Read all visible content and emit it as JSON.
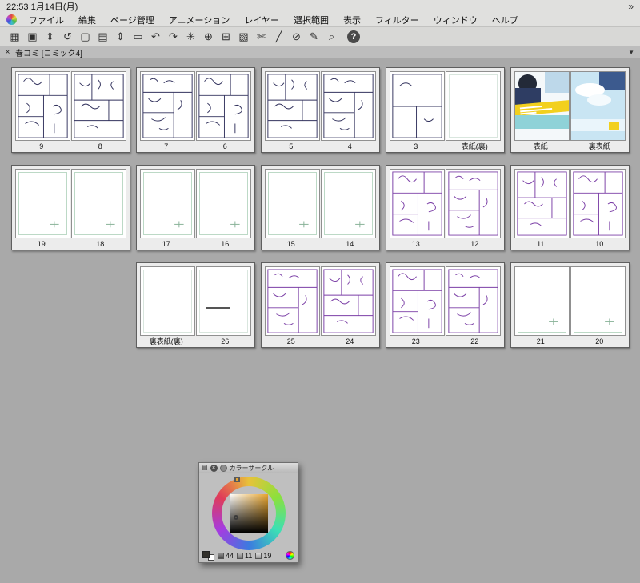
{
  "status_bar": {
    "clock": "22:53  1月14日(月)",
    "overflow_icon": "»"
  },
  "menu_bar": {
    "items": [
      "ファイル",
      "編集",
      "ページ管理",
      "アニメーション",
      "レイヤー",
      "選択範囲",
      "表示",
      "フィルター",
      "ウィンドウ",
      "ヘルプ"
    ]
  },
  "toolbar": {
    "buttons": [
      {
        "name": "page-manager-view-icon",
        "glyph": "▦"
      },
      {
        "name": "two-page-spread-icon",
        "glyph": "▣"
      },
      {
        "name": "page-stepper-icon",
        "glyph": "⇕"
      },
      {
        "name": "rotate-view-icon",
        "glyph": "↺"
      },
      {
        "name": "new-page-icon",
        "glyph": "▢"
      },
      {
        "name": "duplicate-page-icon",
        "glyph": "▤"
      },
      {
        "name": "order-stepper-icon",
        "glyph": "⇕"
      },
      {
        "name": "blank-template-icon",
        "glyph": "▭"
      },
      {
        "name": "undo-icon",
        "glyph": "↶"
      },
      {
        "name": "redo-icon",
        "glyph": "↷"
      },
      {
        "name": "clear-icon",
        "glyph": "✳"
      },
      {
        "name": "transform-icon",
        "glyph": "⊕"
      },
      {
        "name": "grid-icon",
        "glyph": "⊞"
      },
      {
        "name": "select-area-icon",
        "glyph": "▧"
      },
      {
        "name": "scissors-icon",
        "glyph": "✄"
      },
      {
        "name": "line-tool-icon",
        "glyph": "╱"
      },
      {
        "name": "no-tool-icon",
        "glyph": "⊘"
      },
      {
        "name": "pen-tool-icon",
        "glyph": "✎"
      },
      {
        "name": "search-icon",
        "glyph": "⌕"
      },
      {
        "name": "help-icon",
        "glyph": "?",
        "style": "dark"
      }
    ]
  },
  "tab_bar": {
    "close_label": "×",
    "title": "春コミ [コミック4]",
    "dropdown_icon": "▼"
  },
  "pages": {
    "rows": [
      {
        "spreads": [
          {
            "ink": "#33335e",
            "pages": [
              {
                "label": "9",
                "content": "sketch-0"
              },
              {
                "label": "8",
                "content": "sketch-1"
              }
            ]
          },
          {
            "ink": "#33335e",
            "pages": [
              {
                "label": "7",
                "content": "sketch-2"
              },
              {
                "label": "6",
                "content": "sketch-0"
              }
            ]
          },
          {
            "ink": "#33335e",
            "pages": [
              {
                "label": "5",
                "content": "sketch-1"
              },
              {
                "label": "4",
                "content": "sketch-2"
              }
            ]
          },
          {
            "ink": "#33335e",
            "pages": [
              {
                "label": "3",
                "content": "sketch-light"
              },
              {
                "label": "表紙(裏)",
                "content": "blank"
              }
            ]
          },
          {
            "ink": "#33335e",
            "pages": [
              {
                "label": "表紙",
                "content": "cover-front"
              },
              {
                "label": "裏表紙",
                "content": "cover-back"
              }
            ]
          }
        ]
      },
      {
        "spreads": [
          {
            "ink": "#4a7a5a",
            "pages": [
              {
                "label": "19",
                "content": "near-blank"
              },
              {
                "label": "18",
                "content": "near-blank"
              }
            ]
          },
          {
            "ink": "#4a7a5a",
            "pages": [
              {
                "label": "17",
                "content": "near-blank"
              },
              {
                "label": "16",
                "content": "near-blank"
              }
            ]
          },
          {
            "ink": "#4a7a5a",
            "pages": [
              {
                "label": "15",
                "content": "near-blank"
              },
              {
                "label": "14",
                "content": "near-blank"
              }
            ]
          },
          {
            "ink": "#7b3fa6",
            "pages": [
              {
                "label": "13",
                "content": "sketch-0"
              },
              {
                "label": "12",
                "content": "sketch-2"
              }
            ]
          },
          {
            "ink": "#7b3fa6",
            "pages": [
              {
                "label": "11",
                "content": "sketch-1"
              },
              {
                "label": "10",
                "content": "sketch-0"
              }
            ]
          }
        ]
      },
      {
        "spreads": [
          {
            "ink": "#4a7a5a",
            "pages": [
              {
                "label": "裏表紙(裏)",
                "content": "blank"
              },
              {
                "label": "26",
                "content": "colophon"
              }
            ]
          },
          {
            "ink": "#7b3fa6",
            "pages": [
              {
                "label": "25",
                "content": "sketch-2"
              },
              {
                "label": "24",
                "content": "sketch-1"
              }
            ]
          },
          {
            "ink": "#7b3fa6",
            "pages": [
              {
                "label": "23",
                "content": "sketch-0"
              },
              {
                "label": "22",
                "content": "sketch-2"
              }
            ]
          },
          {
            "ink": "#7b3fa6",
            "pages": [
              {
                "label": "21",
                "content": "near-blank"
              },
              {
                "label": "20",
                "content": "near-blank"
              }
            ]
          }
        ]
      }
    ]
  },
  "color_panel": {
    "title": "カラーサークル",
    "menu_icon": "▤",
    "close_icon": "×",
    "values": [
      {
        "value": "44"
      },
      {
        "value": "11"
      },
      {
        "value": "19"
      }
    ],
    "selected_hue": "#e8a52e",
    "foreground_color": "#312f2a",
    "background_color": "#ffffff"
  },
  "palette": {
    "canvas_bg": "#a9a9a9",
    "cover_yellow": "#f2d01e",
    "cover_navy": "#2e3d63",
    "cover_sky": "#c9e5f3"
  }
}
